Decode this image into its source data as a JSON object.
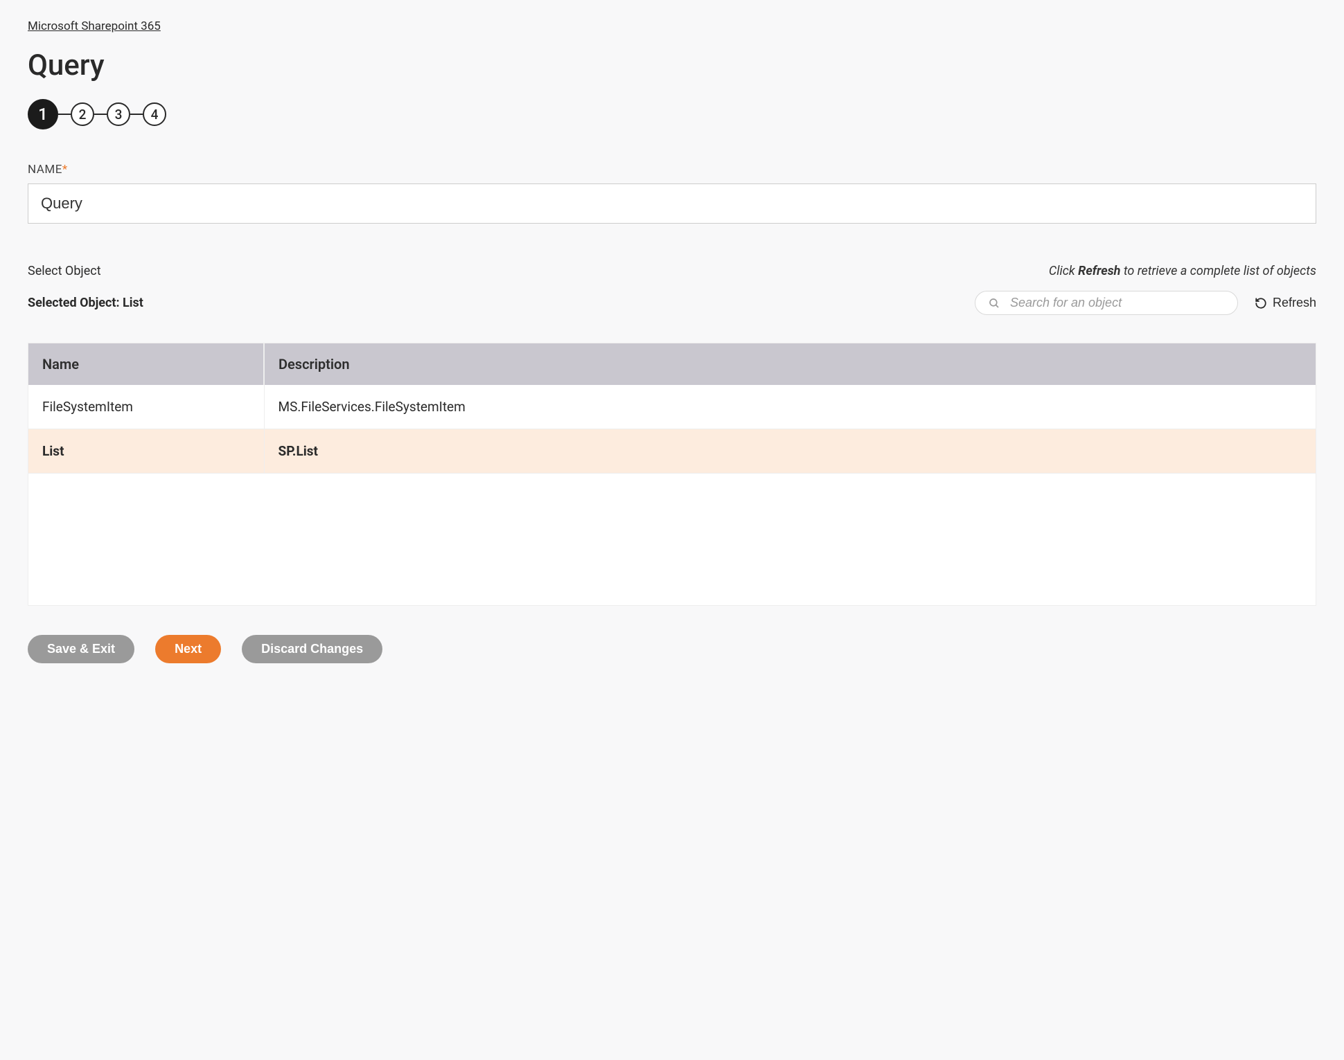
{
  "breadcrumb": {
    "label": "Microsoft Sharepoint 365"
  },
  "page": {
    "title": "Query"
  },
  "stepper": {
    "steps": [
      "1",
      "2",
      "3",
      "4"
    ],
    "active_index": 0
  },
  "name_field": {
    "label": "NAME",
    "value": "Query"
  },
  "select": {
    "label": "Select Object",
    "hint_prefix": "Click ",
    "hint_bold": "Refresh",
    "hint_suffix": " to retrieve a complete list of objects",
    "selected_prefix": "Selected Object: ",
    "selected_value": "List",
    "search_placeholder": "Search for an object",
    "refresh_label": "Refresh"
  },
  "table": {
    "headers": {
      "name": "Name",
      "description": "Description"
    },
    "rows": [
      {
        "name": "FileSystemItem",
        "description": "MS.FileServices.FileSystemItem",
        "selected": false
      },
      {
        "name": "List",
        "description": "SP.List",
        "selected": true
      }
    ]
  },
  "actions": {
    "save_exit": "Save & Exit",
    "next": "Next",
    "discard": "Discard Changes"
  }
}
